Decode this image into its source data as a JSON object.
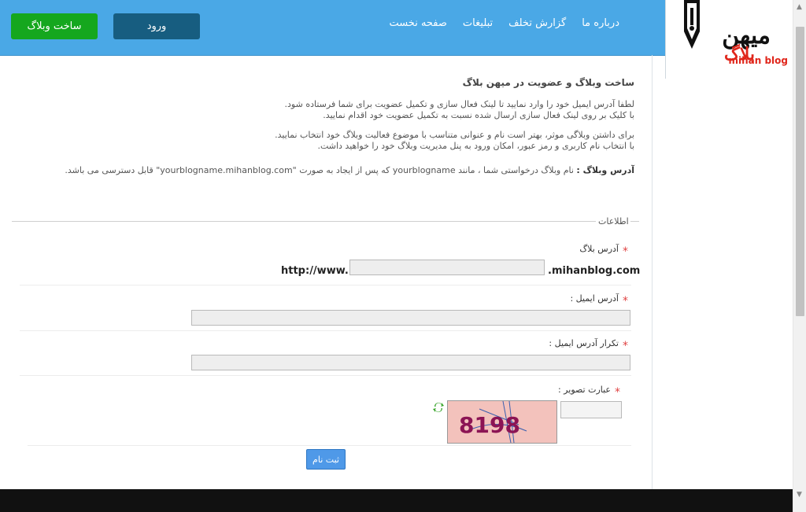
{
  "header": {
    "nav": [
      "صفحه نخست",
      "تبلیغات",
      "گزارش تخلف",
      "درباره ما"
    ],
    "login_label": "ورود",
    "create_label": "ساخت وبلاگ",
    "logo_fa_top": "میهن",
    "logo_fa_bottom": "بلاگ",
    "logo_en": "mihan blog",
    "colors": {
      "header_bg": "#4aa8e6",
      "login_bg": "#175d80",
      "create_bg": "#15a71e"
    }
  },
  "content": {
    "title": "ساخت وبلاگ و عضویت در میهن بلاگ",
    "p1_line1": "لطفا آدرس ایمیل خود را وارد نمایید تا لینک فعال سازی و تکمیل عضویت برای شما فرستاده شود.",
    "p1_line2": "با کلیک بر روی لینک فعال سازی ارسال شده نسبت به تکمیل عضویت خود اقدام نمایید.",
    "p2_line1": "برای داشتن وبلاگی موثر، بهتر است نام و عنوانی متناسب با موضوع فعالیت وبلاگ خود انتخاب نمایید.",
    "p2_line2": "با انتخاب نام کاربری و رمز عبور، امکان ورود به پنل مدیریت وبلاگ خود را خواهید داشت.",
    "p3_bold": "آدرس وبلاگ :",
    "p3_text": " نام وبلاگ درخواستی شما ، مانند yourblogname که پس از ایجاد به صورت \"yourblogname.mihanblog.com\" قابل دسترسی می باشد."
  },
  "form": {
    "legend": "اطلاعات",
    "blog_address_label": "آدرس بلاگ",
    "url_prefix": "http://www.",
    "url_suffix": ".mihanblog.com",
    "blog_address_value": "",
    "email_label": "آدرس ایمیل :",
    "email_value": "",
    "email_repeat_label": "تکرار آدرس ایمیل :",
    "email_repeat_value": "",
    "captcha_label": "عبارت تصویر :",
    "captcha_value": "",
    "captcha_text": "8198",
    "submit_label": "ثبت نام"
  }
}
